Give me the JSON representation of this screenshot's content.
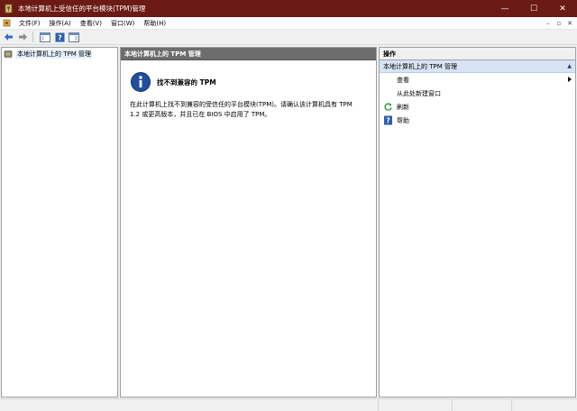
{
  "window": {
    "title": "本地计算机上受信任的平台模块(TPM)管理",
    "controls": {
      "minimize": "—",
      "maximize": "☐",
      "close": "✕"
    },
    "title_bar_color": "#6b1a14"
  },
  "menubar": {
    "items": [
      "文件(F)",
      "操作(A)",
      "查看(V)",
      "窗口(W)",
      "帮助(H)"
    ],
    "mdi": {
      "minimize": "–",
      "restore": "▫",
      "close": "✕"
    }
  },
  "toolbar": {
    "icons": [
      "back-arrow-icon",
      "forward-arrow-icon",
      "console-tree-icon",
      "help-icon",
      "show-hide-action-pane-icon"
    ]
  },
  "tree": {
    "root_label": "本地计算机上的 TPM 管理"
  },
  "center": {
    "header": "本地计算机上的 TPM 管理",
    "message_title": "找不到兼容的 TPM",
    "message_body": "在此计算机上找不到兼容的受信任的平台模块(TPM)。请确认该计算机具有 TPM 1.2 或更高版本，并且已在 BIOS 中启用了 TPM。"
  },
  "actions": {
    "header": "操作",
    "section": "本地计算机上的 TPM 管理",
    "items": [
      {
        "label": "查看",
        "icon": "",
        "submenu": true
      },
      {
        "label": "从此处新建窗口",
        "icon": "",
        "submenu": false
      },
      {
        "label": "刷新",
        "icon": "refresh-icon",
        "submenu": false
      },
      {
        "label": "帮助",
        "icon": "help-icon",
        "submenu": false
      }
    ]
  }
}
